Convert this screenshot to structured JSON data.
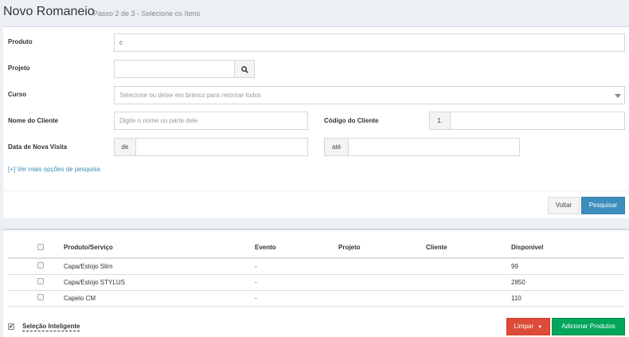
{
  "header": {
    "title": "Novo Romaneio",
    "subtitle": "Passo 2 de 3 - Selecione os Itens"
  },
  "form": {
    "produto_label": "Produto",
    "produto_value": "c",
    "projeto_label": "Projeto",
    "projeto_value": "",
    "curso_label": "Curso",
    "curso_placeholder": "Selecione ou deixe em branco para retornar todos",
    "cliente_label": "Nome do Cliente",
    "cliente_placeholder": "Digite o nome ou parte dele",
    "codigo_label": "Código do Cliente",
    "codigo_prefix": "1.",
    "codigo_value": "",
    "visita_label": "Data de Nova Visita",
    "de_label": "de",
    "de_value": "",
    "ate_label": "até",
    "ate_value": "",
    "more_options": "[+] Ver mais opções de pesquisa",
    "voltar": "Voltar",
    "pesquisar": "Pesquisar"
  },
  "table": {
    "columns": [
      "Produto/Serviço",
      "Evento",
      "Projeto",
      "Cliente",
      "Disponível"
    ],
    "rows": [
      {
        "produto": "Capa/Estojo Slim",
        "evento": "-",
        "projeto": "",
        "cliente": "",
        "disponivel": "99"
      },
      {
        "produto": "Capa/Estojo STYLUS",
        "evento": "-",
        "projeto": "",
        "cliente": "",
        "disponivel": "2850"
      },
      {
        "produto": "Capelo CM",
        "evento": "-",
        "projeto": "",
        "cliente": "",
        "disponivel": "110"
      }
    ]
  },
  "footer": {
    "smart_selection": "Seleção Inteligente",
    "smart_selection_checked": true,
    "limpar": "Limpar",
    "adicionar": "Adicionar Produtos"
  },
  "icons": {
    "search": "search-icon",
    "dropdown": "chevron-down-icon",
    "limpar_caret": "caret-down-icon"
  },
  "colors": {
    "primary": "#3c8dbc",
    "danger": "#dd4b39",
    "success": "#00a65a"
  }
}
